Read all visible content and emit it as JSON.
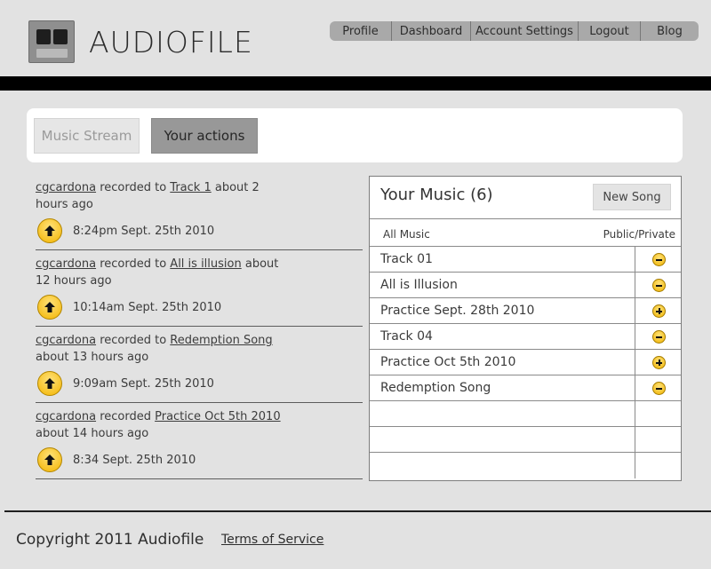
{
  "app": {
    "logo_text": "AUDIOFILE"
  },
  "nav": {
    "items": [
      {
        "label": "Profile",
        "width": 70
      },
      {
        "label": "Dashboard",
        "width": 89
      },
      {
        "label": "Account Settings",
        "width": 121
      },
      {
        "label": "Logout",
        "width": 70
      },
      {
        "label": "Blog",
        "width": 65
      }
    ]
  },
  "tabs": {
    "music_stream": "Music Stream",
    "your_actions": "Your actions"
  },
  "activity": [
    {
      "user": "cgcardona",
      "verb": "recorded to",
      "track": "Track 1",
      "ago": "about 2 hours ago",
      "time": "8:24pm Sept. 25th 2010"
    },
    {
      "user": "cgcardona",
      "verb": "recorded to",
      "track": "All is illusion",
      "ago": "about 12 hours ago",
      "time": "10:14am Sept. 25th 2010"
    },
    {
      "user": "cgcardona",
      "verb": "recorded to",
      "track": "Redemption Song",
      "ago": "about 13 hours ago",
      "time": "9:09am Sept. 25th 2010"
    },
    {
      "user": "cgcardona",
      "verb": "recorded",
      "track": "Practice Oct 5th 2010",
      "ago": "about 14 hours ago",
      "time": "8:34 Sept. 25th 2010"
    }
  ],
  "music": {
    "title": "Your Music (6)",
    "new_song_label": "New Song",
    "col_all": "All Music",
    "col_visibility": "Public/Private",
    "tracks": [
      {
        "name": "Track 01",
        "state": "minus"
      },
      {
        "name": "All is Illusion",
        "state": "minus"
      },
      {
        "name": "Practice Sept. 28th 2010",
        "state": "plus"
      },
      {
        "name": "Track 04",
        "state": "minus"
      },
      {
        "name": "Practice Oct 5th 2010",
        "state": "plus"
      },
      {
        "name": "Redemption Song",
        "state": "minus"
      },
      {
        "name": "",
        "state": ""
      },
      {
        "name": "",
        "state": ""
      },
      {
        "name": "",
        "state": ""
      }
    ]
  },
  "footer": {
    "copyright": "Copyright 2011 Audiofile",
    "terms": "Terms of Service"
  }
}
